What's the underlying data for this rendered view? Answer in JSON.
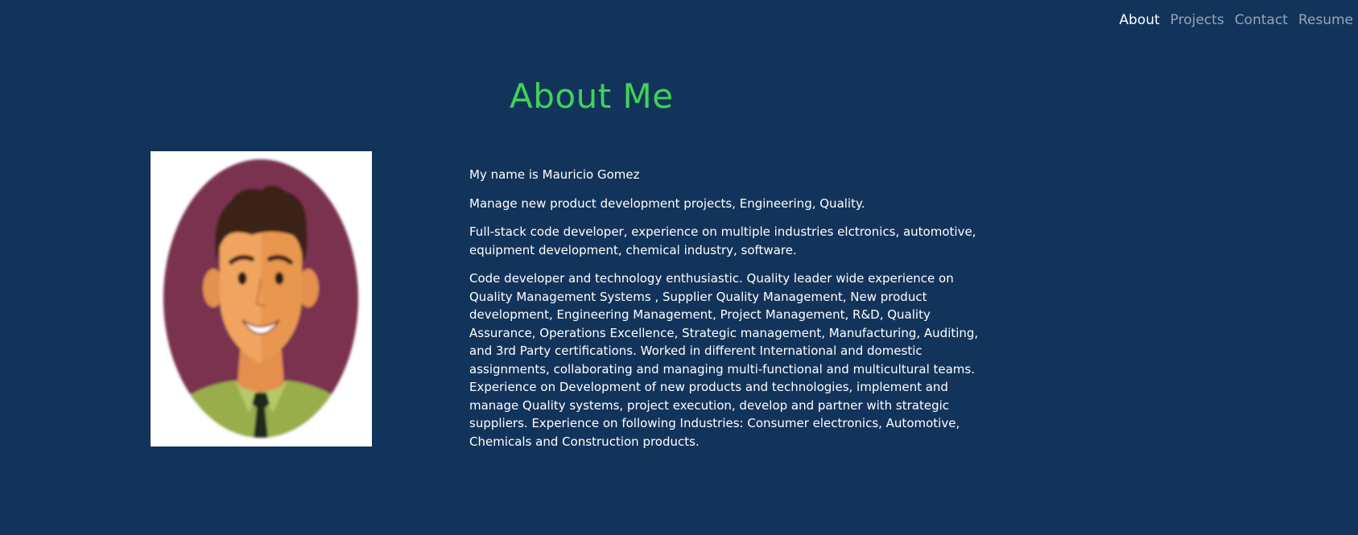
{
  "nav": {
    "items": [
      {
        "label": "About",
        "active": true
      },
      {
        "label": "Projects",
        "active": false
      },
      {
        "label": "Contact",
        "active": false
      },
      {
        "label": "Resume",
        "active": false
      }
    ]
  },
  "main": {
    "title": "About Me",
    "avatar_icon": "cartoon-man-avatar",
    "paragraphs": [
      "My name is Mauricio Gomez",
      "Manage new product development projects, Engineering, Quality.",
      "Full-stack code developer, experience on multiple industries elctronics, automotive, equipment development, chemical industry, software.",
      "Code developer and technology enthusiastic. Quality leader wide experience on Quality Management Systems , Supplier Quality Management, New product development, Engineering Management, Project Management, R&D, Quality Assurance, Operations Excellence, Strategic management, Manufacturing, Auditing, and 3rd Party certifications. Worked in different International and domestic assignments, collaborating and managing multi-functional and multicultural teams. Experience on Development of new products and technologies, implement and manage Quality systems, project execution, develop and partner with strategic suppliers. Experience on following Industries: Consumer electronics, Automotive, Chemicals and Construction products."
    ]
  },
  "colors": {
    "background": "#13345a",
    "title": "#3ed35a",
    "nav_active": "#ffffff",
    "nav_inactive": "#9aa6b6"
  }
}
